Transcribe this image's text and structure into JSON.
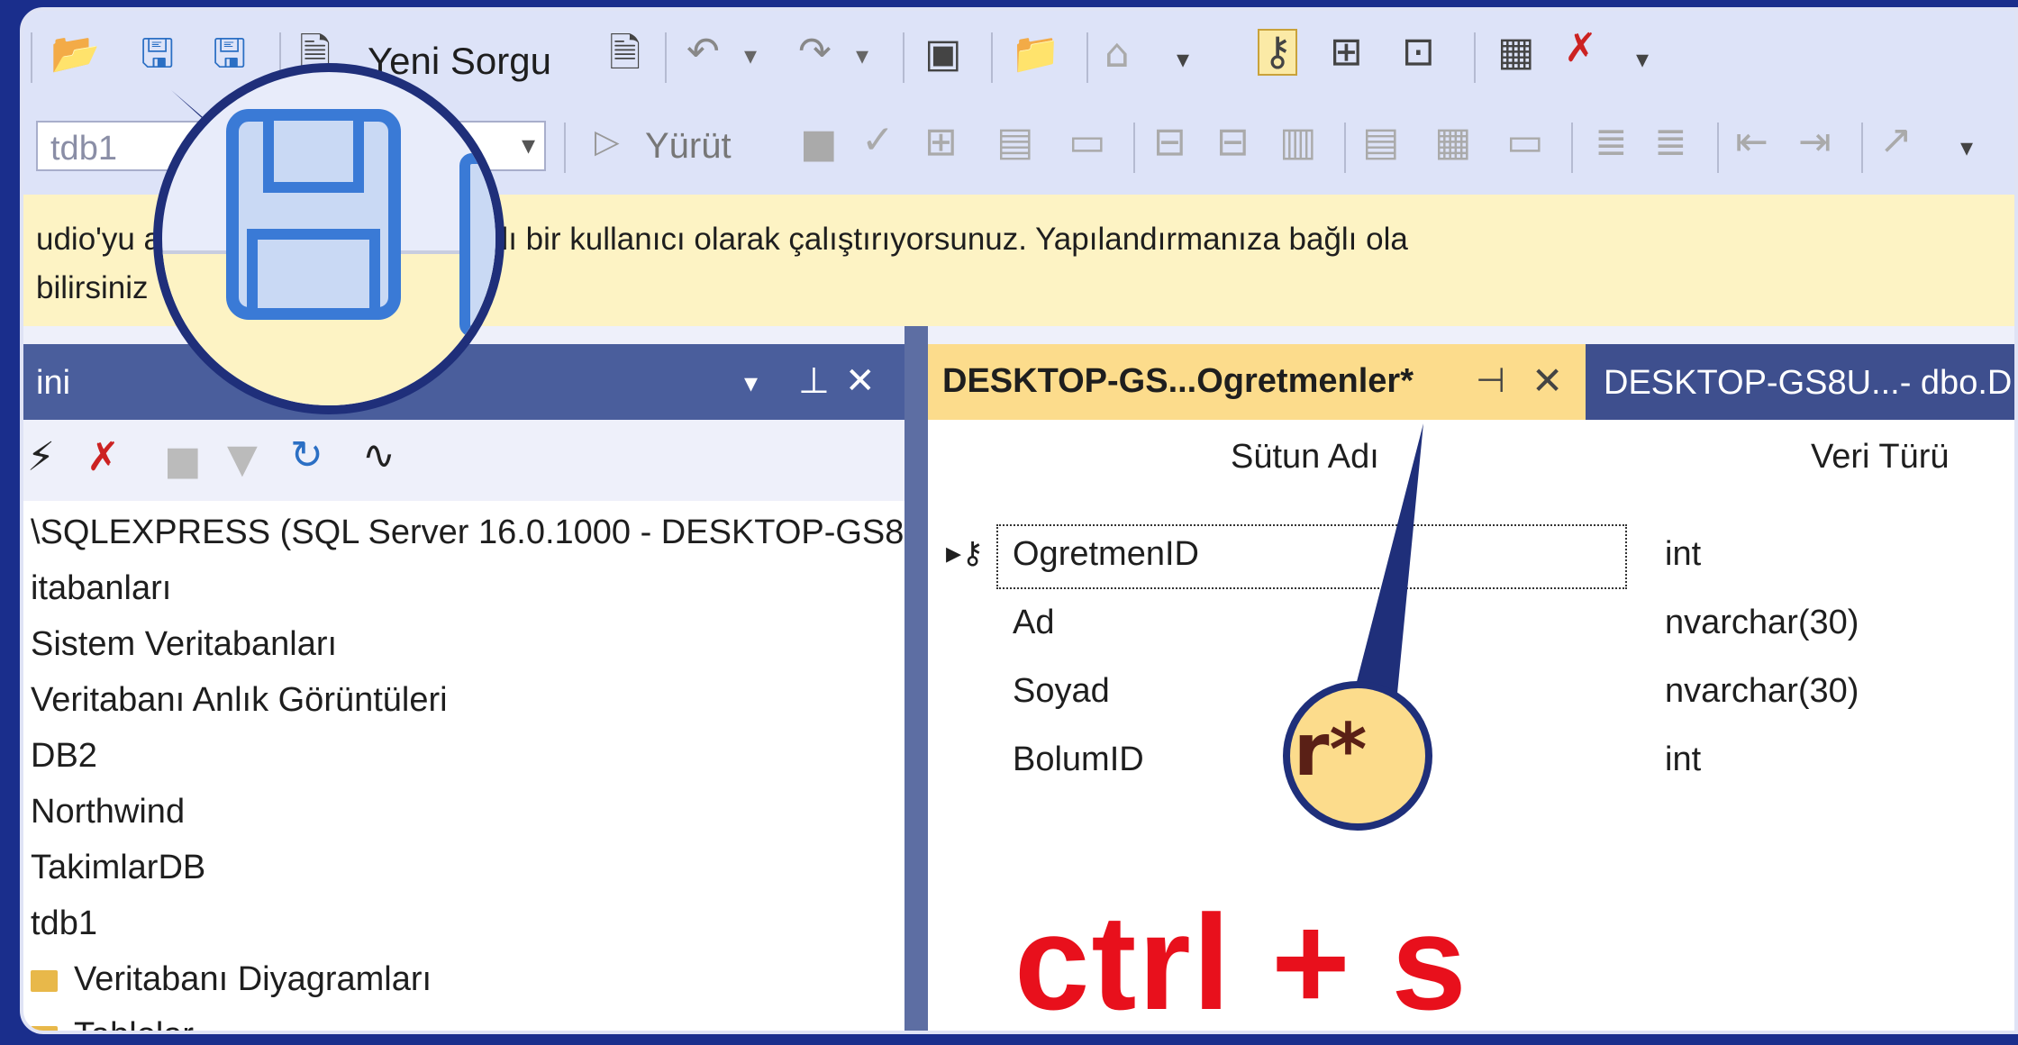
{
  "toolbar": {
    "new_query_label": "Yeni Sorgu",
    "database_combo_value": "tdb1",
    "execute_label": "Yürüt"
  },
  "warning": {
    "line1": "udio'yu                      açtığınız kullanıcıdan farklı bir kullanıcı olarak çalıştırıyorsunuz. Yapılandırmanıza bağlı ola",
    "line2": "bilirsiniz"
  },
  "object_explorer": {
    "title": "ini",
    "tree": [
      {
        "label": "\\SQLEXPRESS (SQL Server 16.0.1000 - DESKTOP-GS8",
        "folder": false
      },
      {
        "label": "itabanları",
        "folder": false
      },
      {
        "label": "Sistem Veritabanları",
        "folder": false
      },
      {
        "label": "Veritabanı Anlık Görüntüleri",
        "folder": false
      },
      {
        "label": "DB2",
        "folder": false
      },
      {
        "label": "Northwind",
        "folder": false
      },
      {
        "label": "TakimlarDB",
        "folder": false
      },
      {
        "label": "tdb1",
        "folder": false
      },
      {
        "label": "Veritabanı Diyagramları",
        "folder": true
      },
      {
        "label": "Tablolar",
        "folder": true
      }
    ]
  },
  "designer": {
    "active_tab": "DESKTOP-GS...Ogretmenler*",
    "second_tab": "DESKTOP-GS8U...- dbo.D",
    "columns_header": "Sütun Adı",
    "types_header": "Veri Türü",
    "rows": [
      {
        "name": "OgretmenID",
        "type": "int"
      },
      {
        "name": "Ad",
        "type": "nvarchar(30)"
      },
      {
        "name": "Soyad",
        "type": "nvarchar(30)"
      },
      {
        "name": "BolumID",
        "type": "int"
      }
    ]
  },
  "overlay": {
    "zoom_text": "r*",
    "shortcut": "ctrl + s"
  },
  "colors": {
    "background": "#1a2e8c",
    "active_tab": "#fcdc8c",
    "warning_bar": "#fdf3c4",
    "shortcut_text": "#e8101c"
  }
}
